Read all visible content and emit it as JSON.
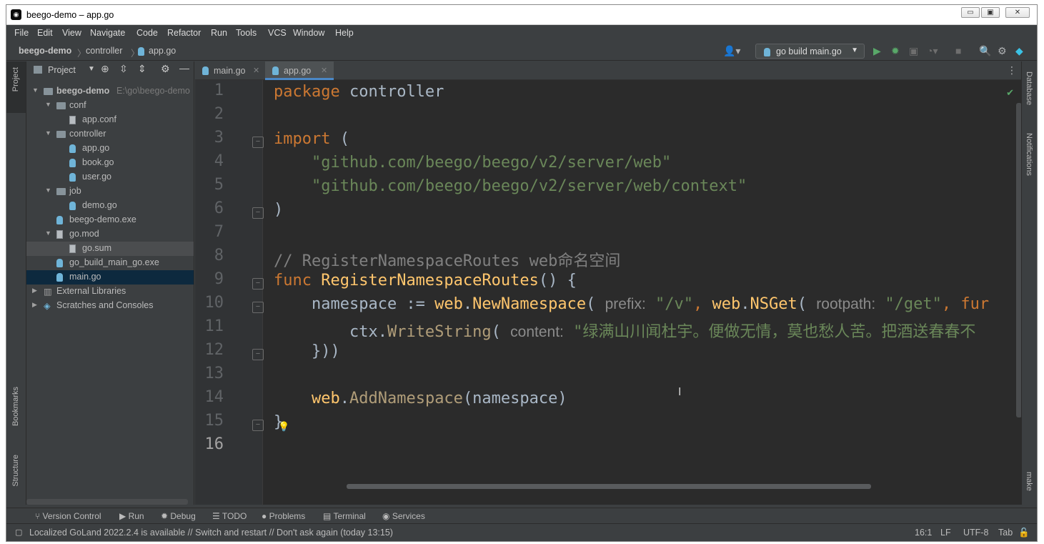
{
  "window": {
    "title": "beego-demo – app.go",
    "controls": {
      "minimize": "▭",
      "restore": "▣",
      "close": "✕"
    }
  },
  "menu": [
    "File",
    "Edit",
    "View",
    "Navigate",
    "Code",
    "Refactor",
    "Run",
    "Tools",
    "VCS",
    "Window",
    "Help"
  ],
  "breadcrumb": {
    "project": "beego-demo",
    "folder": "controller",
    "file": "app.go"
  },
  "toolbar": {
    "run_config": "go build main.go"
  },
  "left_strip": {
    "project": "Project",
    "bookmarks": "Bookmarks",
    "structure": "Structure"
  },
  "right_strip": {
    "database": "Database",
    "notifications": "Notifications",
    "make": "make"
  },
  "project_panel": {
    "title": "Project",
    "tree": [
      {
        "label": "beego-demo",
        "extra": "E:\\go\\beego-demo",
        "type": "folder",
        "depth": 0,
        "expanded": true
      },
      {
        "label": "conf",
        "type": "folder",
        "depth": 1,
        "expanded": true
      },
      {
        "label": "app.conf",
        "type": "text",
        "depth": 2
      },
      {
        "label": "controller",
        "type": "folder",
        "depth": 1,
        "expanded": true
      },
      {
        "label": "app.go",
        "type": "go",
        "depth": 2
      },
      {
        "label": "book.go",
        "type": "go",
        "depth": 2
      },
      {
        "label": "user.go",
        "type": "go",
        "depth": 2
      },
      {
        "label": "job",
        "type": "folder",
        "depth": 1,
        "expanded": true
      },
      {
        "label": "demo.go",
        "type": "go",
        "depth": 2
      },
      {
        "label": "beego-demo.exe",
        "type": "exe",
        "depth": 1
      },
      {
        "label": "go.mod",
        "type": "text",
        "depth": 1,
        "expanded": true
      },
      {
        "label": "go.sum",
        "type": "text",
        "depth": 2,
        "selected": true
      },
      {
        "label": "go_build_main_go.exe",
        "type": "exe",
        "depth": 1
      },
      {
        "label": "main.go",
        "type": "go",
        "depth": 1,
        "current": true
      },
      {
        "label": "External Libraries",
        "type": "lib",
        "depth": 0,
        "expanded": false
      },
      {
        "label": "Scratches and Consoles",
        "type": "scratch",
        "depth": 0,
        "expanded": false
      }
    ]
  },
  "tabs": [
    {
      "label": "main.go",
      "active": false
    },
    {
      "label": "app.go",
      "active": true
    }
  ],
  "editor": {
    "line_numbers": [
      "1",
      "2",
      "3",
      "4",
      "5",
      "6",
      "7",
      "8",
      "9",
      "10",
      "11",
      "12",
      "13",
      "14",
      "15",
      "16"
    ],
    "lines": [
      [
        {
          "t": "package ",
          "c": "kw"
        },
        {
          "t": "controller",
          "c": "pk"
        }
      ],
      [],
      [
        {
          "t": "import ",
          "c": "kw"
        },
        {
          "t": "(",
          "c": ""
        }
      ],
      [
        {
          "t": "    \"github.com/beego/beego/v2/server/web\"",
          "c": "str"
        }
      ],
      [
        {
          "t": "    \"github.com/beego/beego/v2/server/web/context\"",
          "c": "str"
        }
      ],
      [
        {
          "t": ")",
          "c": ""
        }
      ],
      [],
      [
        {
          "t": "// RegisterNamespaceRoutes web命名空间",
          "c": "cm"
        }
      ],
      [
        {
          "t": "func ",
          "c": "kw"
        },
        {
          "t": "RegisterNamespaceRoutes",
          "c": "fn"
        },
        {
          "t": "() {",
          "c": ""
        }
      ],
      [
        {
          "t": "    namespace := ",
          "c": ""
        },
        {
          "t": "web",
          "c": "fn"
        },
        {
          "t": ".",
          "c": ""
        },
        {
          "t": "NewNamespace",
          "c": "fn"
        },
        {
          "t": "( ",
          "c": ""
        },
        {
          "t": "prefix:",
          "c": "hint"
        },
        {
          "t": " \"/v\"",
          "c": "str"
        },
        {
          "t": ", ",
          "c": "kw"
        },
        {
          "t": "web",
          "c": "fn"
        },
        {
          "t": ".",
          "c": ""
        },
        {
          "t": "NSGet",
          "c": "fn"
        },
        {
          "t": "( ",
          "c": ""
        },
        {
          "t": "rootpath:",
          "c": "hint"
        },
        {
          "t": " \"/get\"",
          "c": "str"
        },
        {
          "t": ", ",
          "c": "kw"
        },
        {
          "t": "fur",
          "c": "kw"
        }
      ],
      [
        {
          "t": "        ctx.",
          "c": ""
        },
        {
          "t": "WriteString",
          "c": "meth"
        },
        {
          "t": "( ",
          "c": ""
        },
        {
          "t": "content:",
          "c": "hint"
        },
        {
          "t": " \"绿满山川闻杜宇。便做无情，莫也愁人苦。把酒送春春不",
          "c": "str"
        }
      ],
      [
        {
          "t": "    }))",
          "c": ""
        }
      ],
      [],
      [
        {
          "t": "    ",
          "c": ""
        },
        {
          "t": "web",
          "c": "fn"
        },
        {
          "t": ".",
          "c": ""
        },
        {
          "t": "AddNamespace",
          "c": "meth"
        },
        {
          "t": "(namespace)",
          "c": ""
        }
      ],
      [
        {
          "t": "}",
          "c": ""
        }
      ],
      []
    ]
  },
  "bottom_tools": [
    "Version Control",
    "Run",
    "Debug",
    "TODO",
    "Problems",
    "Terminal",
    "Services"
  ],
  "status": {
    "message": "Localized GoLand 2022.2.4 is available // Switch and restart // Don't ask again (today 13:15)",
    "position": "16:1",
    "line_sep": "LF",
    "encoding": "UTF-8",
    "indent": "Tab"
  },
  "colors": {
    "keyword": "#cc7832",
    "string": "#6a8759",
    "comment": "#808080",
    "function": "#ffc66d",
    "background": "#2b2b2b",
    "panel": "#3c3f41",
    "selection": "#0d293e"
  }
}
